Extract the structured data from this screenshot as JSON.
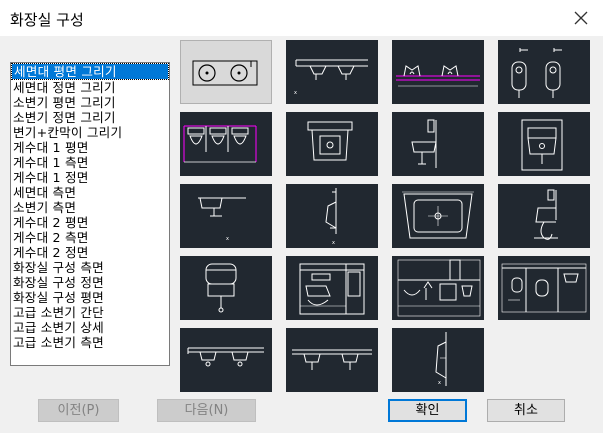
{
  "window": {
    "title": "화장실 구성"
  },
  "list": {
    "items": [
      "세면대 평면 그리기",
      "세면대 정면 그리기",
      "소변기 평면 그리기",
      "소변기 정면 그리기",
      "변기+칸막이 그리기",
      "게수대 1 평면",
      "게수대 1 측면",
      "게수대 1 정면",
      "세면대 측면",
      "소변기 측면",
      "게수대 2 평면",
      "게수대 2 측면",
      "게수대 2 정면",
      "화장실 구성 측면",
      "화장실 구성 정면",
      "화장실 구성 평면",
      "고급 소변기 간단",
      "고급 소변기 상세",
      "고급 소변기 측면"
    ],
    "selected_index": 0
  },
  "preview": {
    "tiles": [
      "sink-plan-thumbnail",
      "sink-front-thumbnail",
      "urinal-plan-thumbnail",
      "urinal-front-thumbnail",
      "toilet-partition-thumbnail",
      "mop-sink-1-plan-thumbnail",
      "mop-sink-1-side-thumbnail",
      "mop-sink-1-front-thumbnail",
      "sink-side-thumbnail",
      "urinal-side-thumbnail",
      "mop-sink-2-plan-thumbnail",
      "mop-sink-2-side-thumbnail",
      "mop-sink-2-front-thumbnail",
      "restroom-side-thumbnail",
      "restroom-front-thumbnail",
      "restroom-plan-thumbnail",
      "premium-urinal-simple-thumbnail",
      "premium-urinal-detail-thumbnail",
      "premium-urinal-side-thumbnail"
    ]
  },
  "buttons": {
    "prev": "이전(P)",
    "next": "다음(N)",
    "ok": "확인",
    "cancel": "취소"
  },
  "colors": {
    "accent": "#0078d7",
    "tile_bg": "#212830",
    "cad_magenta": "#ff00ff"
  }
}
